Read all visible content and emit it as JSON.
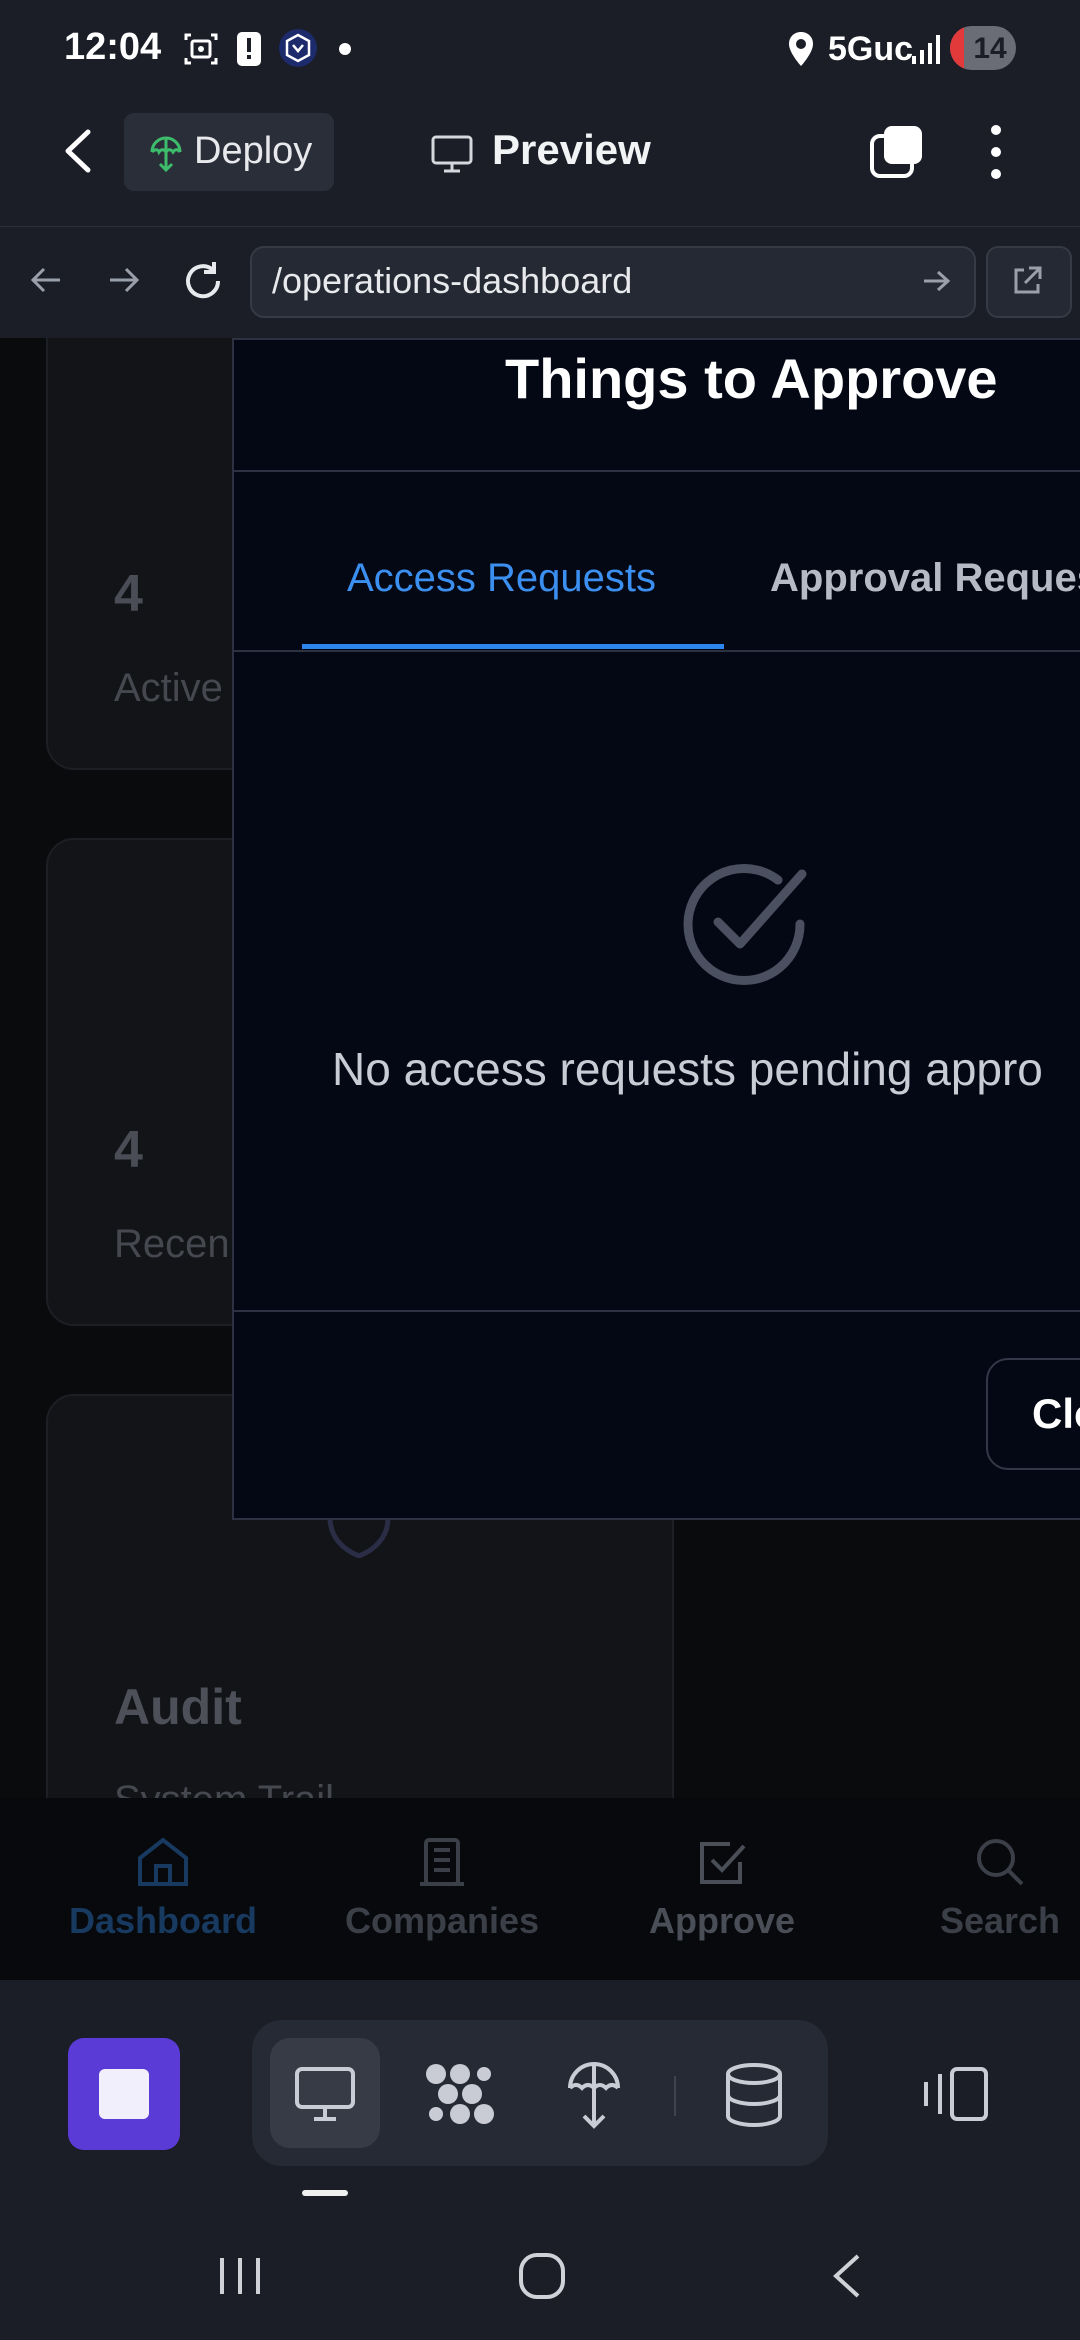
{
  "status_bar": {
    "time": "12:04",
    "network": "5Guc",
    "battery": "14",
    "icons": [
      "screenshot-icon",
      "alert-icon",
      "crypto-app-icon",
      "dot-icon",
      "location-icon",
      "signal-icon"
    ]
  },
  "header": {
    "deploy_label": "Deploy",
    "preview_label": "Preview"
  },
  "url_bar": {
    "url": "/operations-dashboard"
  },
  "background_page": {
    "cards": [
      {
        "number": "4",
        "label": "Active"
      },
      {
        "number": "4",
        "label": "Recen"
      },
      {
        "title": "Audit",
        "subtitle": "System Trail"
      }
    ]
  },
  "modal": {
    "title": "Things to Approve",
    "tabs": [
      {
        "label": "Access Requests",
        "active": true
      },
      {
        "label": "Approval Reques",
        "active": false
      }
    ],
    "empty_message": "No access requests pending appro",
    "close_label": "Clo"
  },
  "app_nav": {
    "items": [
      {
        "label": "Dashboard",
        "icon": "home-icon",
        "active": true
      },
      {
        "label": "Companies",
        "icon": "building-icon",
        "active": false
      },
      {
        "label": "Approve",
        "icon": "check-square-icon",
        "active": false
      },
      {
        "label": "Search",
        "icon": "search-icon",
        "active": false
      }
    ]
  },
  "colors": {
    "accent_blue": "#2d86ee",
    "stop_purple": "#5a3bd6",
    "deploy_green": "#3dbd6c",
    "battery_red": "#e23a3a"
  }
}
